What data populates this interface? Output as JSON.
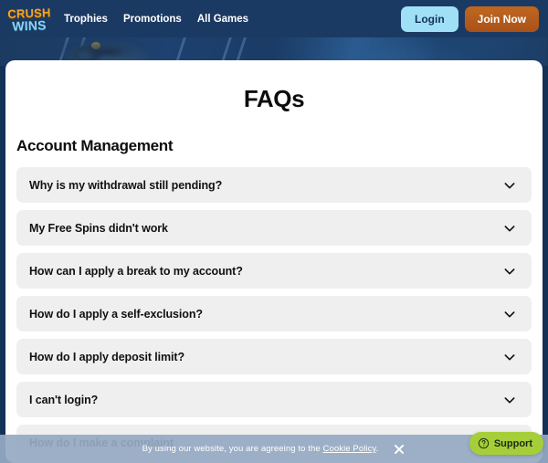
{
  "brand": {
    "logo_line1": "CRUSH",
    "logo_line2": "WINS"
  },
  "nav": {
    "links": [
      {
        "label": "Trophies"
      },
      {
        "label": "Promotions"
      },
      {
        "label": "All Games"
      }
    ],
    "login_label": "Login",
    "join_label": "Join Now"
  },
  "main": {
    "page_title": "FAQs",
    "section_title": "Account Management",
    "faqs": [
      {
        "question": "Why is my withdrawal still pending?",
        "icon": "chevron-down-icon"
      },
      {
        "question": "My Free Spins didn't work",
        "icon": "chevron-down-icon"
      },
      {
        "question": "How can I apply a break to my account?",
        "icon": "chevron-down-icon"
      },
      {
        "question": "How do I apply a self-exclusion?",
        "icon": "chevron-down-icon"
      },
      {
        "question": "How do I apply deposit limit?",
        "icon": "chevron-down-icon"
      },
      {
        "question": "I can't login?",
        "icon": "chevron-down-icon"
      },
      {
        "question": "How do I make a complaint",
        "icon": "chevron-down-icon"
      }
    ]
  },
  "cookie_banner": {
    "text_before": "By using our website, you are agreeing to the",
    "link_label": "Cookie Policy",
    "text_after": ".",
    "close_icon": "close-icon"
  },
  "support_widget": {
    "label": "Support",
    "icon": "question-circle-icon"
  },
  "colors": {
    "header_bg": "#1b3a63",
    "page_bg": "#143156",
    "login_btn": "#9fe0f7",
    "join_btn": "#b45c1c",
    "logo_orange": "#f5a623",
    "logo_blue": "#8fd3f4",
    "faq_item_bg": "#efeff0",
    "support_green": "#a6ce39",
    "cookie_bar_bg": "#96aac3"
  }
}
